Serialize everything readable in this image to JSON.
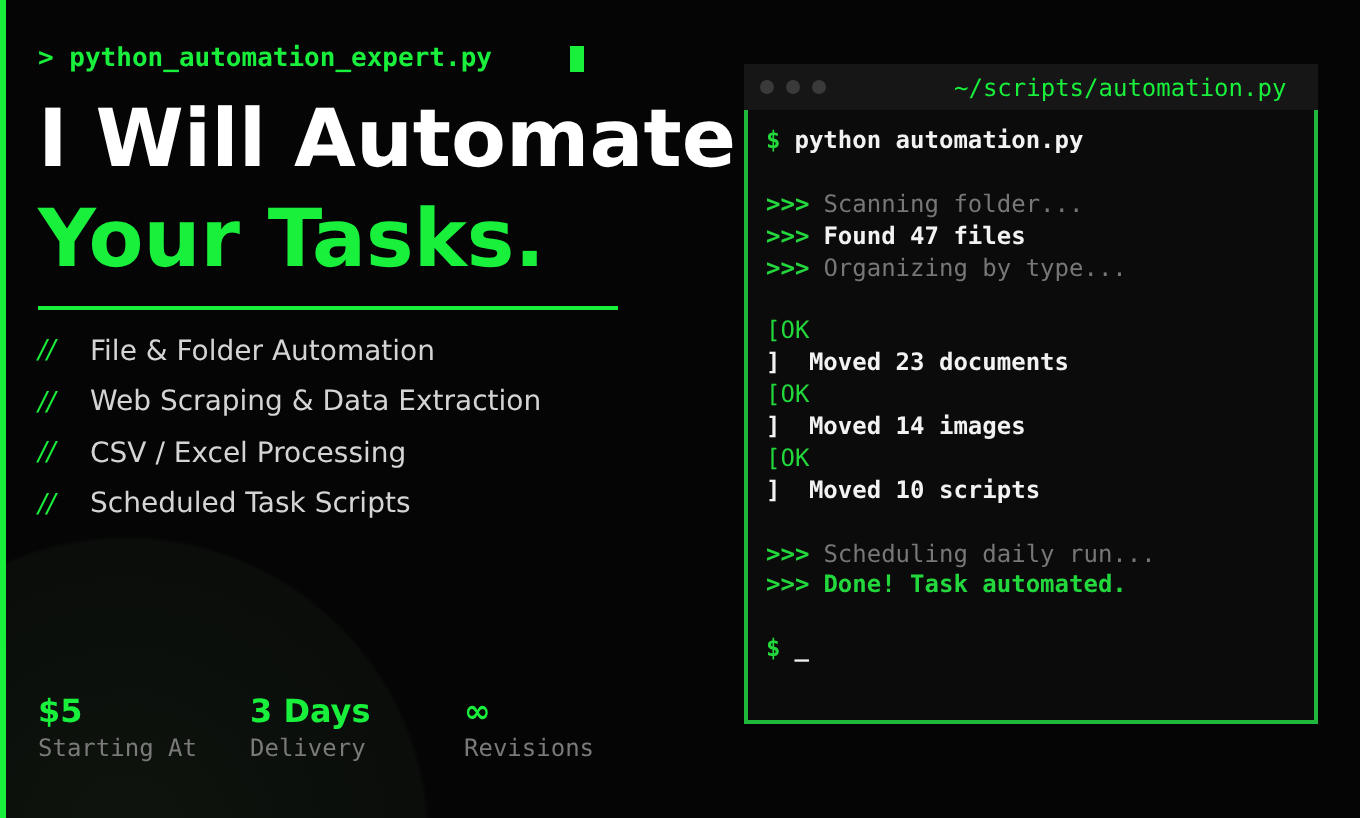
{
  "prompt_line": {
    "text": "> python_automation_expert.py",
    "cursor": true
  },
  "headline": {
    "line_1": "I Will Automate",
    "line_2": "Your Tasks."
  },
  "services": [
    {
      "marker": "//",
      "label": "File & Folder Automation"
    },
    {
      "marker": "//",
      "label": "Web Scraping & Data Extraction"
    },
    {
      "marker": "//",
      "label": "CSV / Excel Processing"
    },
    {
      "marker": "//",
      "label": "Scheduled Task Scripts"
    }
  ],
  "stats": [
    {
      "value": "$5",
      "label": "Starting At"
    },
    {
      "value": "3 Days",
      "label": "Delivery"
    },
    {
      "value": "∞",
      "label": "Revisions"
    }
  ],
  "terminal": {
    "title": "~/scripts/automation.py",
    "lines": [
      {
        "kind": "command",
        "prompt": "$",
        "text": "python automation.py"
      },
      {
        "kind": "blank"
      },
      {
        "kind": "log",
        "prompt": ">>>",
        "text": "Scanning folder...",
        "color": "#777777"
      },
      {
        "kind": "log",
        "prompt": ">>>",
        "text": "Found 47 files",
        "color": "#f2f2f2"
      },
      {
        "kind": "log",
        "prompt": ">>>",
        "text": "Organizing by type...",
        "color": "#777777"
      },
      {
        "kind": "blank"
      },
      {
        "kind": "tag",
        "text": "[OK"
      },
      {
        "kind": "result",
        "prompt": "]",
        "text": "Moved 23 documents"
      },
      {
        "kind": "tag",
        "text": "[OK"
      },
      {
        "kind": "result",
        "prompt": "]",
        "text": "Moved 14 images"
      },
      {
        "kind": "tag",
        "text": "[OK"
      },
      {
        "kind": "result",
        "prompt": "]",
        "text": "Moved 10 scripts"
      },
      {
        "kind": "blank"
      },
      {
        "kind": "log",
        "prompt": ">>>",
        "text": "Scheduling daily run...",
        "color": "#777777"
      },
      {
        "kind": "log",
        "prompt": ">>>",
        "text": "Done! Task automated.",
        "color": "#22d83c"
      },
      {
        "kind": "blank"
      },
      {
        "kind": "command",
        "prompt": "$",
        "text": "_"
      }
    ]
  }
}
